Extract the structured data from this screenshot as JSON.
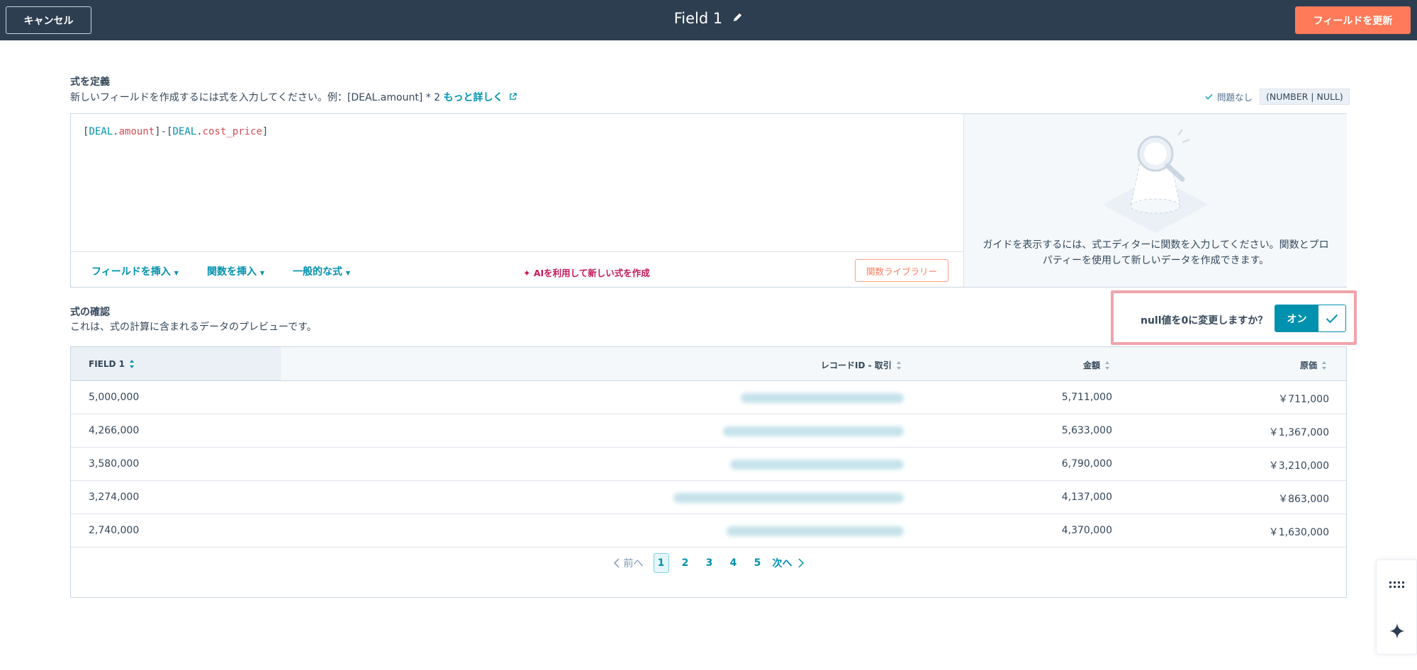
{
  "header": {
    "cancel_label": "キャンセル",
    "title": "Field 1",
    "update_label": "フィールドを更新"
  },
  "define": {
    "title": "式を定義",
    "description": "新しいフィールドを作成するには式を入力してください。例：[DEAL.amount] * 2",
    "learn_more": "もっと詳しく",
    "status_ok": "問題なし",
    "type_badge": "(NUMBER | NULL)",
    "formula": {
      "open1": "[",
      "obj1": "DEAL",
      "dot1": ".",
      "prop1": "amount",
      "close1_minus_open2": "]-[",
      "obj2": "DEAL",
      "dot2": ".",
      "prop2": "cost_price",
      "close2": "]"
    },
    "toolbar": {
      "insert_field": "フィールドを挿入",
      "insert_function": "関数を挿入",
      "common_formulas": "一般的な式",
      "ai_create": "AIを利用して新しい式を作成",
      "function_library": "関数ライブラリー"
    },
    "guide_text": "ガイドを表示するには、式エディターに関数を入力してください。関数とプロパティーを使用して新しいデータを作成できます。"
  },
  "confirm": {
    "title": "式の確認",
    "description": "これは、式の計算に含まれるデータのプレビューです。",
    "null_question": "null値を0に変更しますか？",
    "toggle_label": "オン"
  },
  "table": {
    "columns": [
      "FIELD 1",
      "レコードID - 取引",
      "金額",
      "原価"
    ],
    "rows": [
      {
        "field1": "5,000,000",
        "amount": "5,711,000",
        "cost": "￥711,000"
      },
      {
        "field1": "4,266,000",
        "amount": "5,633,000",
        "cost": "￥1,367,000"
      },
      {
        "field1": "3,580,000",
        "amount": "6,790,000",
        "cost": "￥3,210,000"
      },
      {
        "field1": "3,274,000",
        "amount": "4,137,000",
        "cost": "￥863,000"
      },
      {
        "field1": "2,740,000",
        "amount": "4,370,000",
        "cost": "￥1,630,000"
      }
    ]
  },
  "pagination": {
    "prev": "前へ",
    "pages": [
      "1",
      "2",
      "3",
      "4",
      "5"
    ],
    "current": "1",
    "next": "次へ"
  },
  "colors": {
    "header_bg": "#2d3e50",
    "accent_orange": "#ff7a59",
    "link_teal": "#0091ae",
    "ai_magenta": "#c2185b",
    "highlight_pink": "#f2a3ab"
  },
  "icons": {
    "title_edit": "pencil-icon",
    "learn_more": "external-link-icon",
    "status": "check-icon",
    "guide": "magnifier-illustration",
    "ai": "sparkle-icon",
    "sort": "sort-icon",
    "float_1": "grid-dots-icon",
    "float_2": "sparkle-icon"
  }
}
